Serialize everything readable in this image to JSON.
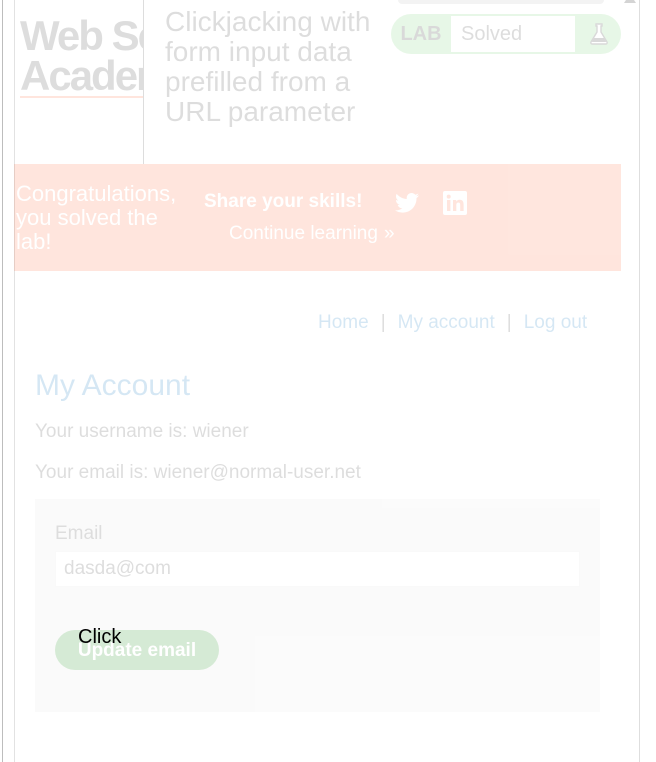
{
  "header": {
    "logo_line1": "Web Security",
    "logo_line2": "Academy",
    "lab_title": "Clickjacking with form input data prefilled from a URL parameter",
    "lab_badge": "LAB",
    "lab_state": "Solved",
    "flask_icon": "flask-icon"
  },
  "banner": {
    "congrats": "Congratulations, you solved the lab!",
    "share": "Share your skills!",
    "continue": "Continue learning",
    "continue_chevron": "»",
    "icons": [
      "twitter-icon",
      "linkedin-icon"
    ]
  },
  "nav": {
    "home": "Home",
    "sep1": "|",
    "my_account": "My account",
    "sep2": "|",
    "log_out": "Log out"
  },
  "account": {
    "title": "My Account",
    "username_line": "Your username is: wiener",
    "email_line": "Your email is: wiener@normal-user.net"
  },
  "form": {
    "email_label": "Email",
    "email_value": "dasda@com",
    "submit": "Update email"
  },
  "decoy": {
    "text": "Click"
  },
  "colors": {
    "brand_orange": "#ff6633",
    "link_blue": "#0071bc",
    "lab_green": "#70d16d",
    "button_green": "#008000"
  },
  "iframe_opacity": 0.16
}
